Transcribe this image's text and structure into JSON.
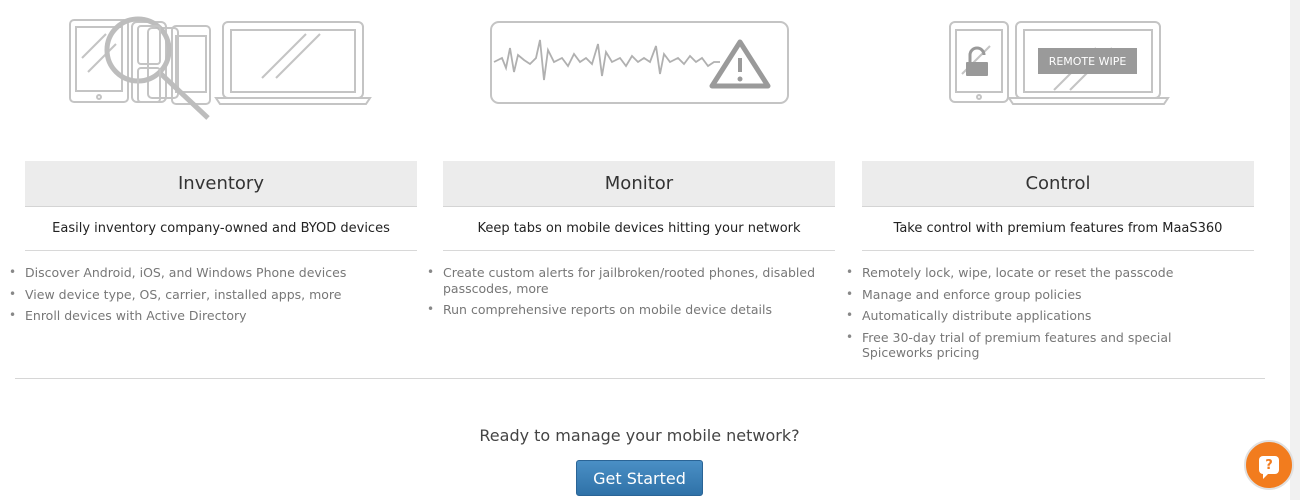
{
  "illustrations": {
    "control_screen_label": "REMOTE WIPE"
  },
  "columns": [
    {
      "title": "Inventory",
      "subtitle": "Easily inventory company-owned and BYOD devices",
      "items": [
        "Discover Android, iOS, and Windows Phone devices",
        "View device type, OS, carrier, installed apps, more",
        "Enroll devices with Active Directory"
      ]
    },
    {
      "title": "Monitor",
      "subtitle": "Keep tabs on mobile devices hitting your network",
      "items": [
        "Create custom alerts for jailbroken/rooted phones, disabled passcodes, more",
        "Run comprehensive reports on mobile device details"
      ]
    },
    {
      "title": "Control",
      "subtitle": "Take control with premium features from MaaS360",
      "items": [
        "Remotely lock, wipe, locate or reset the passcode",
        "Manage and enforce group policies",
        "Automatically distribute applications",
        "Free 30-day trial of premium features and special Spiceworks pricing"
      ]
    }
  ],
  "cta": {
    "question": "Ready to manage your mobile network?",
    "button_label": "Get Started"
  },
  "chat": {
    "icon_glyph": "?",
    "accent_color": "#f27c1e"
  },
  "colors": {
    "button_blue": "#2f72a8",
    "header_gray": "#ececec"
  }
}
